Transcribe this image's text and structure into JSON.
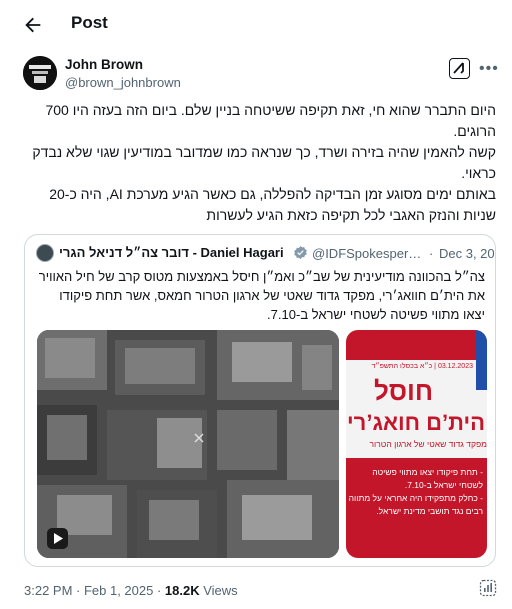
{
  "header": {
    "title": "Post"
  },
  "author": {
    "name": "John Brown",
    "handle": "@brown_johnbrown"
  },
  "tweet": {
    "text": "היום התברר שהוא חי,  זאת תקיפה  ששיטחה בניין שלם. ביום הזה בעזה היו 700 הרוגים.\nקשה להאמין שהיה בזירה ושרד, כך שנראה כמו שמדובר במודיעין שגוי שלא נבדק כראוי.\nבאותם ימים מסוגע זמן הבדיקה להפללה, גם כאשר הגיע מערכת AI, היה כ-20 שניות והנזק האגבי לכל תקיפה כזאת הגיע לעשרות"
  },
  "quote": {
    "name": "דובר צה״ל דניאל הגרי - Daniel Hagari",
    "handle": "@IDFSpokesperson",
    "separator": "·",
    "date": "Dec 3, 2023",
    "text": "צה״ל בהכוונה מודיעינית של שב״כ ואמ״ן חיסל באמצעות מטוס קרב של חיל האוויר את הית׳ם חוואג׳רי, מפקד גדוד שאטי של ארגון הטרור חמאס, אשר תחת פיקודו יצאו מתווי פשיטה לשטחי ישראל ב-7.10.",
    "image": {
      "date_strip": "03.12.2023 | כ״א בכסלו התשפ״ד",
      "headline": "חוסל",
      "name_line": "היתʼם חואגʼרי",
      "subtitle": "מפקד גדוד שאטי של ארגון הטרור",
      "bullets": "- תחת פיקודו יצאו מתווי פשיטה לשטחי ישראל ב-7.10.\n- כחלק מתפקידו היה אחראי על מתווה רבים נגד תושבי מדינת ישראל."
    }
  },
  "footer": {
    "time": "3:22 PM · Feb 1, 2025 · ",
    "views_count": "18.2K",
    "views_label": " Views"
  }
}
